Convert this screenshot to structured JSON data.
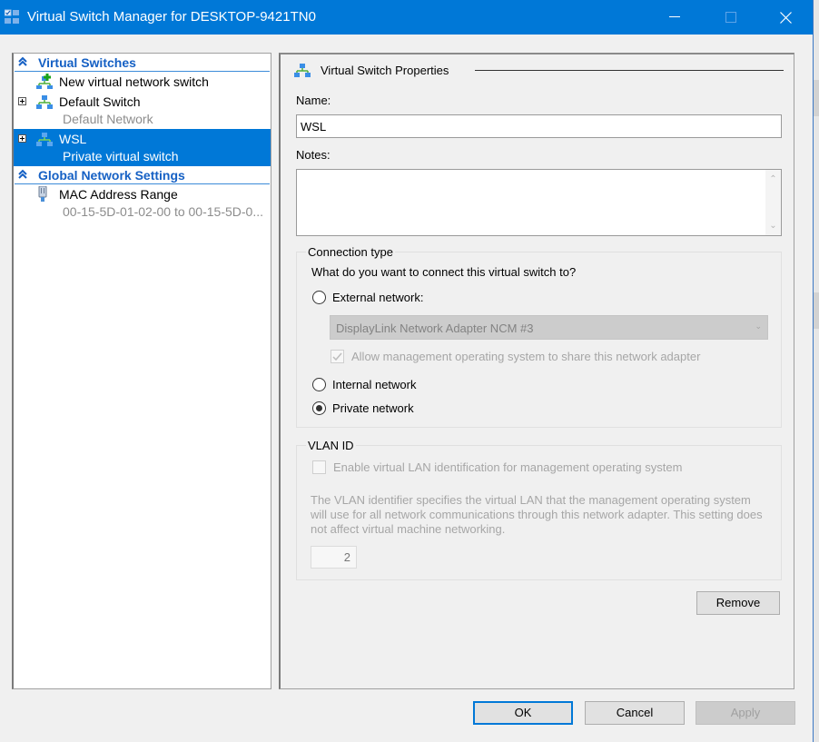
{
  "window": {
    "title": "Virtual Switch Manager for DESKTOP-9421TN0",
    "controls": {
      "minimize": "minimize",
      "maximize": "maximize",
      "close": "close"
    },
    "accent_color": "#0078d7"
  },
  "tree": {
    "sections": [
      {
        "label": "Virtual Switches",
        "items": [
          {
            "label": "New virtual network switch",
            "sublabel": null,
            "icon": "new-switch-icon",
            "expandable": false,
            "selected": false
          },
          {
            "label": "Default Switch",
            "sublabel": "Default Network",
            "icon": "network-switch-icon",
            "expandable": true,
            "selected": false
          },
          {
            "label": "WSL",
            "sublabel": "Private virtual switch",
            "icon": "network-switch-icon",
            "expandable": true,
            "selected": true
          }
        ]
      },
      {
        "label": "Global Network Settings",
        "items": [
          {
            "label": "MAC Address Range",
            "sublabel": "00-15-5D-01-02-00 to 00-15-5D-0...",
            "icon": "network-adapter-icon",
            "expandable": false,
            "selected": false
          }
        ]
      }
    ]
  },
  "properties": {
    "heading": "Virtual Switch Properties",
    "name_label": "Name:",
    "name_value": "WSL",
    "notes_label": "Notes:",
    "notes_value": "",
    "connection_type": {
      "title": "Connection type",
      "question": "What do you want to connect this virtual switch to?",
      "options": [
        {
          "label": "External network:",
          "checked": false
        },
        {
          "label": "Internal network",
          "checked": false
        },
        {
          "label": "Private network",
          "checked": true
        }
      ],
      "adapter_selected": "DisplayLink Network Adapter NCM #3",
      "allow_management_label": "Allow management operating system to share this network adapter",
      "allow_management_checked": true,
      "external_controls_enabled": false
    },
    "vlan": {
      "title": "VLAN ID",
      "enable_label": "Enable virtual LAN identification for management operating system",
      "enable_checked": false,
      "description": "The VLAN identifier specifies the virtual LAN that the management operating system will use for all network communications through this network adapter. This setting does not affect virtual machine networking.",
      "id_value": "2"
    },
    "remove_label": "Remove"
  },
  "footer": {
    "ok_label": "OK",
    "cancel_label": "Cancel",
    "apply_label": "Apply",
    "apply_enabled": false
  }
}
